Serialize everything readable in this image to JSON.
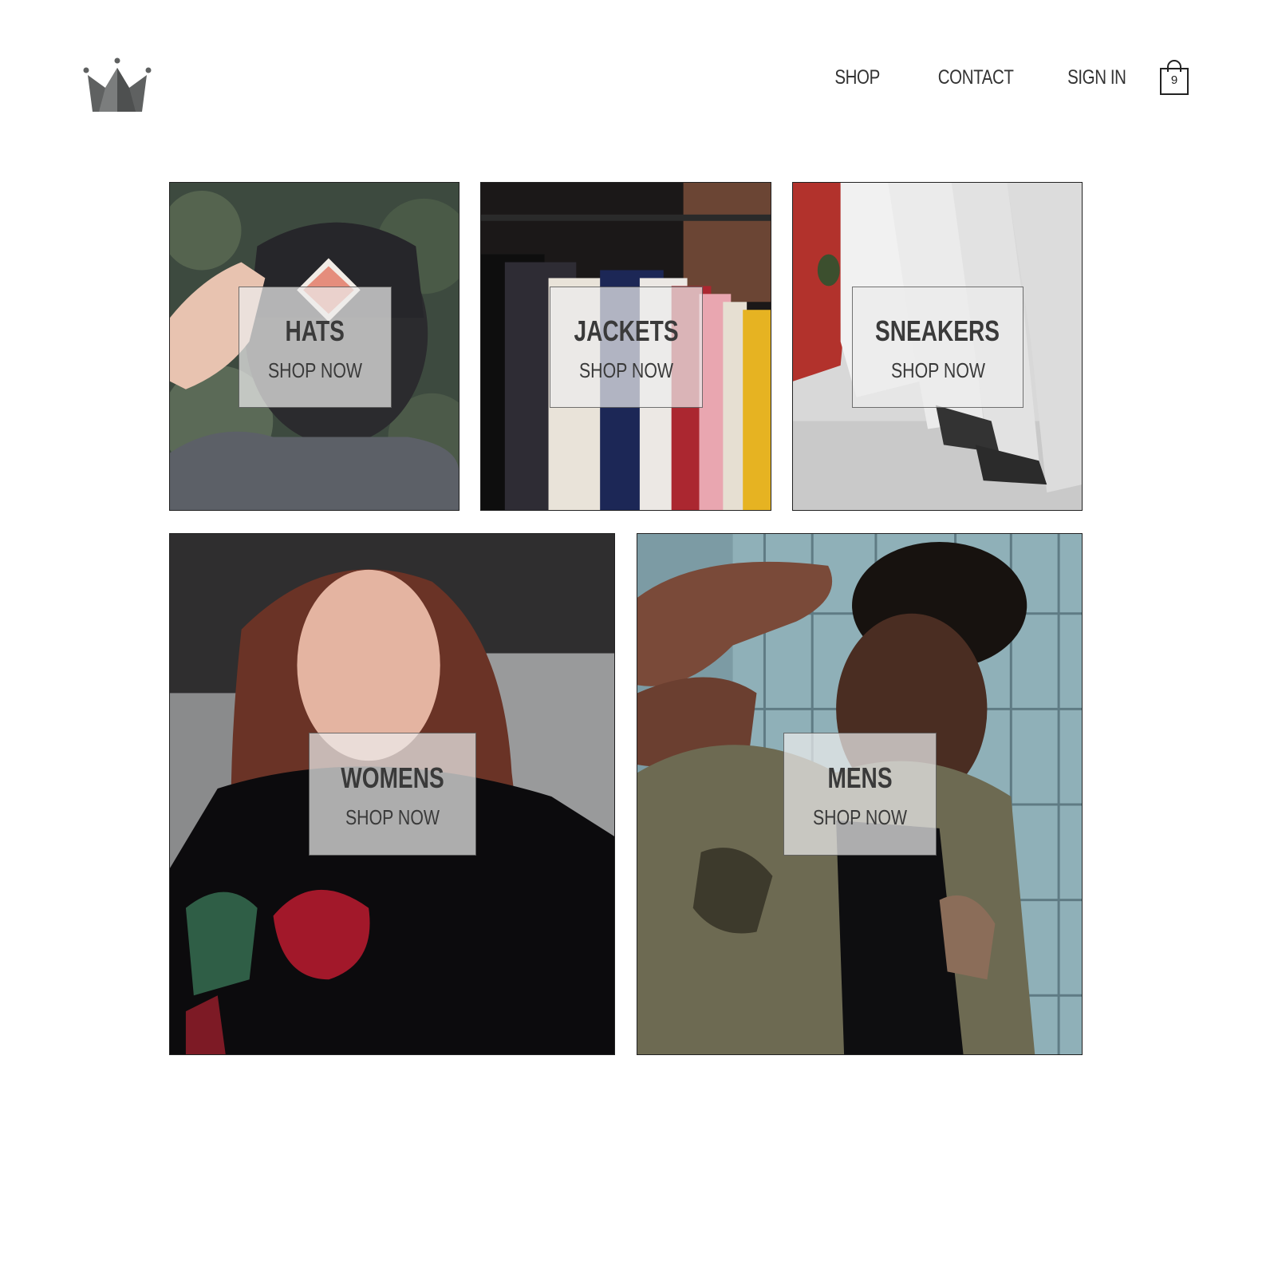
{
  "header": {
    "logo": {
      "icon": "crown-icon",
      "color": "#5f6161"
    },
    "nav": [
      {
        "label": "SHOP"
      },
      {
        "label": "CONTACT"
      },
      {
        "label": "SIGN IN"
      }
    ],
    "cart": {
      "icon": "shopping-bag-icon",
      "count": "9"
    }
  },
  "categories": [
    {
      "title": "HATS",
      "cta": "SHOP NOW"
    },
    {
      "title": "JACKETS",
      "cta": "SHOP NOW"
    },
    {
      "title": "SNEAKERS",
      "cta": "SHOP NOW"
    },
    {
      "title": "WOMENS",
      "cta": "SHOP NOW"
    },
    {
      "title": "MENS",
      "cta": "SHOP NOW"
    }
  ]
}
